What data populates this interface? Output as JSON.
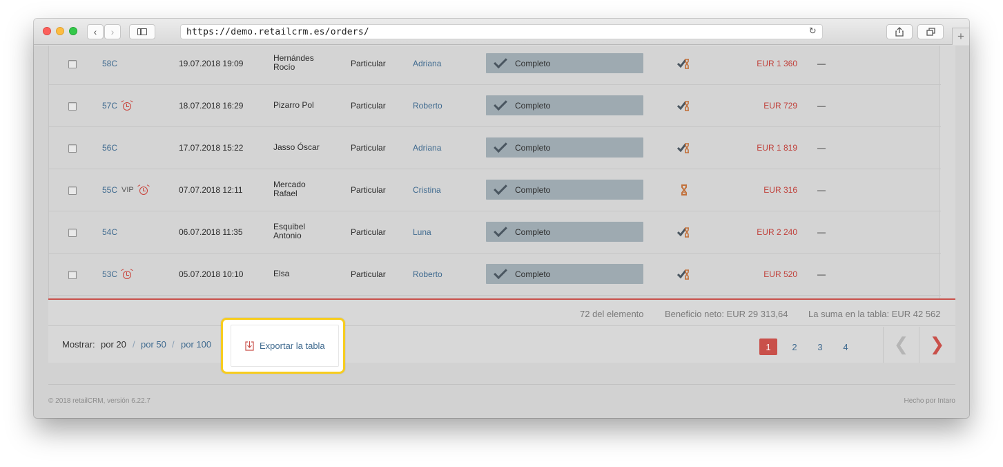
{
  "browser": {
    "url": "https://demo.retailcrm.es/orders/",
    "back_glyph": "‹",
    "forward_glyph": "›",
    "new_tab_glyph": "+",
    "reload_glyph": "↻"
  },
  "orders": [
    {
      "id": "58C",
      "vip": "",
      "alarm": false,
      "date": "19.07.2018 19:09",
      "customer": [
        "Hernándes",
        "Rocío"
      ],
      "type": "Particular",
      "manager": "Adriana",
      "status": "Completo",
      "shipping_icon": "delivery-check-icon",
      "total": "EUR 1 360",
      "extra": "—"
    },
    {
      "id": "57C",
      "vip": "",
      "alarm": true,
      "date": "18.07.2018 16:29",
      "customer": [
        "Pizarro Pol"
      ],
      "type": "Particular",
      "manager": "Roberto",
      "status": "Completo",
      "shipping_icon": "delivery-check-icon",
      "total": "EUR 729",
      "extra": "—"
    },
    {
      "id": "56C",
      "vip": "",
      "alarm": false,
      "date": "17.07.2018 15:22",
      "customer": [
        "Jasso Óscar"
      ],
      "type": "Particular",
      "manager": "Adriana",
      "status": "Completo",
      "shipping_icon": "delivery-check-icon",
      "total": "EUR 1 819",
      "extra": "—"
    },
    {
      "id": "55C",
      "vip": "VIP",
      "alarm": true,
      "date": "07.07.2018 12:11",
      "customer": [
        "Mercado",
        "Rafael"
      ],
      "type": "Particular",
      "manager": "Cristina",
      "status": "Completo",
      "shipping_icon": "hourglass-icon",
      "total": "EUR 316",
      "extra": "—"
    },
    {
      "id": "54C",
      "vip": "",
      "alarm": false,
      "date": "06.07.2018 11:35",
      "customer": [
        "Esquibel",
        "Antonio"
      ],
      "type": "Particular",
      "manager": "Luna",
      "status": "Completo",
      "shipping_icon": "delivery-check-icon",
      "total": "EUR 2 240",
      "extra": "—"
    },
    {
      "id": "53C",
      "vip": "",
      "alarm": true,
      "date": "05.07.2018 10:10",
      "customer": [
        "Elsa"
      ],
      "type": "Particular",
      "manager": "Roberto",
      "status": "Completo",
      "shipping_icon": "delivery-check-icon",
      "total": "EUR 520",
      "extra": "—"
    }
  ],
  "totals": {
    "count": "72 del elemento",
    "net_profit": "Beneficio neto: EUR 29 313,64",
    "table_sum": "La suma en la tabla: EUR 42 562"
  },
  "pager": {
    "show_label": "Mostrar:",
    "per_page_current": "por 20",
    "per_page_50": "por 50",
    "per_page_100": "por 100",
    "separator": "/",
    "export_label": "Exportar la tabla",
    "pages": [
      "1",
      "2",
      "3",
      "4"
    ],
    "active_page": "1",
    "prev_glyph": "❮",
    "next_glyph": "❯"
  },
  "colors": {
    "highlight": "#f7cd1f",
    "accent_red": "#c9504a",
    "link_blue": "#3f6a8f",
    "status_bg": "#9eaab1"
  },
  "footer": {
    "copyright": "© 2018 retailCRM, versión 6.22.7",
    "made_by": "Hecho por Intaro"
  }
}
